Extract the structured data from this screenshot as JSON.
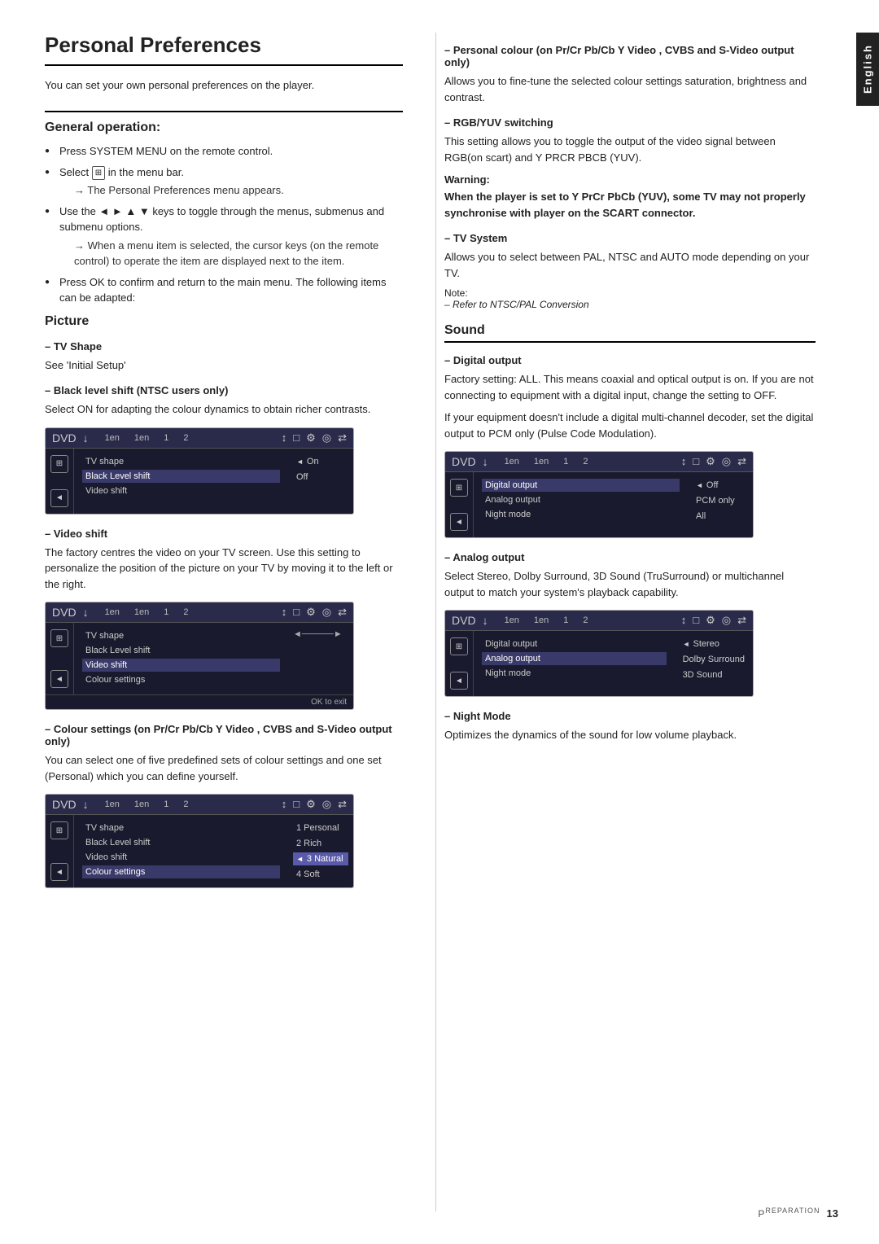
{
  "page": {
    "title": "Personal Preferences",
    "side_tab": "English",
    "intro": "You can set your own personal preferences on the player.",
    "footer": {
      "label": "Preparation",
      "page_number": "13"
    }
  },
  "left": {
    "general_operation": {
      "heading": "General operation:",
      "steps": [
        "Press SYSTEM MENU on the remote control.",
        "Select  in the menu bar.",
        "Use the ◄ ► ▲ ▼ keys to toggle through the menus, submenus and submenu options.",
        "Press OK to confirm and return to the main menu. The following items can be adapted:"
      ],
      "step2_arrow": "The Personal Preferences menu appears.",
      "step3_arrow": "When a menu item is selected, the cursor keys (on the remote control) to operate the item are displayed next to the item."
    },
    "picture": {
      "heading": "Picture",
      "tv_shape": {
        "label": "TV Shape",
        "content": "See 'Initial Setup'"
      },
      "black_level": {
        "label": "Black level shift (NTSC users only)",
        "content": "Select ON for adapting the colour dynamics to obtain richer contrasts.",
        "screen": {
          "icons_top": [
            "⟳",
            "□",
            "⚙",
            "◎",
            "⇄"
          ],
          "nums": [
            "1en",
            "1en",
            "1",
            "2"
          ],
          "menu_items": [
            "TV shape",
            "Black Level shift",
            "Video shift"
          ],
          "options": [
            "On",
            "Off"
          ],
          "selected_option": "On"
        }
      },
      "video_shift": {
        "label": "Video shift",
        "content": "The factory centres the video on your TV screen. Use this setting to personalize the position of the picture on your TV by moving it to the left or the right.",
        "screen": {
          "menu_items": [
            "TV shape",
            "Black Level shift",
            "Video shift",
            "Colour settings"
          ],
          "footer_text": "OK to exit"
        }
      },
      "colour_settings": {
        "label": "Colour settings  (on Pr/Cr Pb/Cb Y Video , CVBS and S-Video output only)",
        "content": "You can select one of five predefined sets of colour settings and one set (Personal) which you can define yourself.",
        "screen": {
          "menu_items": [
            "TV shape",
            "Black Level shift",
            "Video shift",
            "Colour settings"
          ],
          "options": [
            "1 Personal",
            "2 Rich",
            "3 Natural",
            "4 Soft"
          ],
          "selected_option": "3 Natural"
        }
      }
    }
  },
  "right": {
    "personal_colour": {
      "label": "Personal colour  (on Pr/Cr Pb/Cb Y Video , CVBS and S-Video output only)",
      "content": "Allows you to fine-tune the selected colour settings saturation, brightness and contrast."
    },
    "rgb_yuv": {
      "label": "RGB/YUV switching",
      "content": "This setting allows you to toggle the output of the video signal between RGB(on scart) and Y PRCR PBCB (YUV).",
      "warning": {
        "label": "Warning:",
        "text": "When the player is set to Y PrCr PbCb (YUV), some TV may not properly synchronise with player on the SCART connector."
      }
    },
    "tv_system": {
      "label": "TV System",
      "content": "Allows you to select between PAL, NTSC and AUTO mode depending on your TV.",
      "note": "– Refer to NTSC/PAL Conversion"
    },
    "sound": {
      "heading": "Sound",
      "digital_output": {
        "label": "Digital output",
        "content1": "Factory setting: ALL. This means coaxial and optical output is on. If you are not connecting to equipment with a digital input, change the setting to OFF.",
        "content2": "If your equipment doesn't include a digital multi-channel decoder, set the digital output to PCM only (Pulse Code Modulation).",
        "screen": {
          "menu_items": [
            "Digital output",
            "Analog output",
            "Night mode"
          ],
          "options": [
            "Off",
            "PCM only",
            "All"
          ],
          "selected_option": "Off"
        }
      },
      "analog_output": {
        "label": "Analog output",
        "content": "Select Stereo, Dolby Surround, 3D Sound (TruSurround) or multichannel output to match your system's playback capability.",
        "screen": {
          "menu_items": [
            "Digital output",
            "Analog output",
            "Night mode"
          ],
          "options": [
            "Stereo",
            "Dolby Surround",
            "3D Sound"
          ],
          "selected_option": "Stereo"
        }
      },
      "night_mode": {
        "label": "Night Mode",
        "content": "Optimizes the dynamics of the sound for low volume playback."
      }
    }
  }
}
